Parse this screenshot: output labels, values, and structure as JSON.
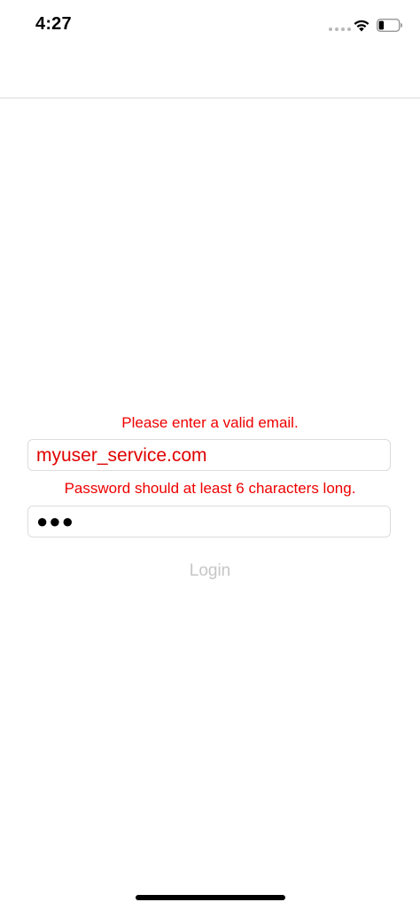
{
  "status_bar": {
    "time": "4:27",
    "signal": "cellular-signal-icon",
    "wifi": "wifi-icon",
    "battery": "battery-icon",
    "battery_level": 0.25
  },
  "form": {
    "email_error": "Please enter a valid email.",
    "email_value": "myuser_service.com",
    "password_error": "Password should at least 6 characters long.",
    "password_value": "●●●",
    "login_label": "Login"
  },
  "colors": {
    "error": "#ee0000",
    "disabled_button": "#c6c6c6",
    "field_border": "#dcdcdc"
  }
}
